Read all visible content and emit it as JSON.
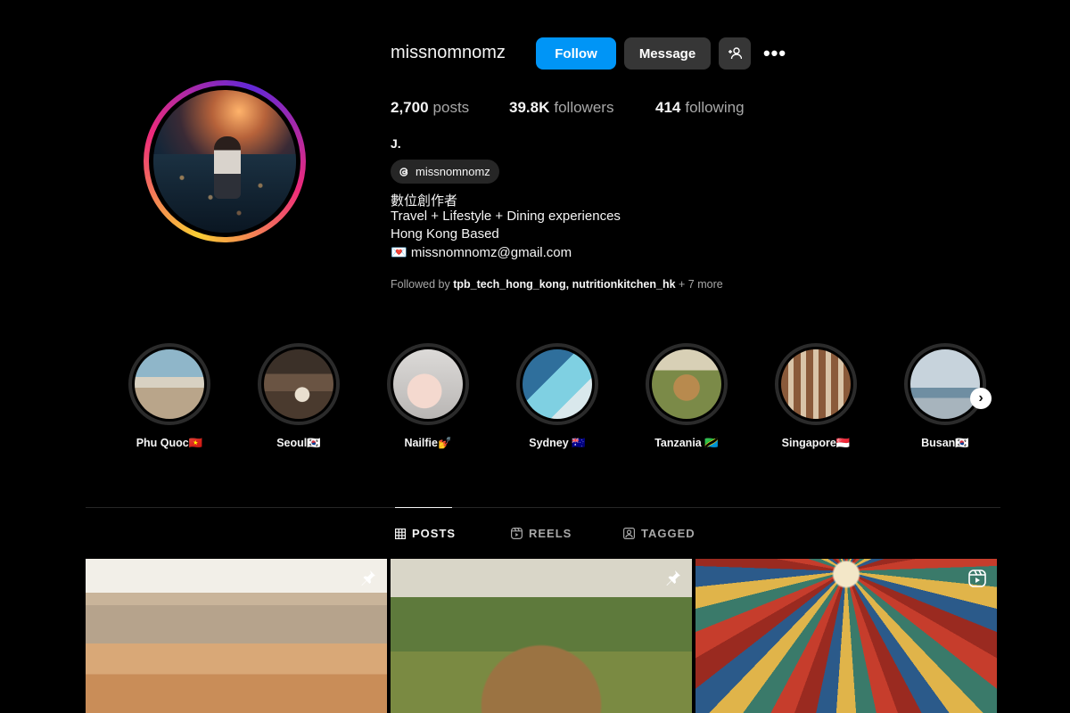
{
  "profile": {
    "username": "missnomnomz",
    "follow_label": "Follow",
    "message_label": "Message",
    "more_label": "•••",
    "stats": {
      "posts_count": "2,700",
      "posts_label": "posts",
      "followers_count": "39.8K",
      "followers_label": "followers",
      "following_count": "414",
      "following_label": "following"
    },
    "display_name": "J.",
    "threads_handle": "missnomnomz",
    "bio": [
      "數位創作者",
      "Travel + Lifestyle + Dining experiences",
      "Hong Kong Based",
      "💌  missnomnomz@gmail.com"
    ],
    "followed_by_prefix": "Followed by",
    "followed_by_user1": "tpb_tech_hong_kong",
    "followed_by_sep": ",",
    "followed_by_user2": "nutritionkitchen_hk",
    "followed_by_suffix": "+ 7 more"
  },
  "highlights": [
    {
      "label": "Phu Quoc🇻🇳"
    },
    {
      "label": "Seoul🇰🇷"
    },
    {
      "label": "Nailfie💅"
    },
    {
      "label": "Sydney 🇦🇺"
    },
    {
      "label": "Tanzania 🇹🇿"
    },
    {
      "label": "Singapore🇸🇬"
    },
    {
      "label": "Busan🇰🇷"
    }
  ],
  "tabs": {
    "posts": "POSTS",
    "reels": "REELS",
    "tagged": "TAGGED"
  },
  "posts": [
    {
      "indicator": "pin-icon"
    },
    {
      "indicator": "pin-icon"
    },
    {
      "indicator": "reel-icon"
    }
  ]
}
